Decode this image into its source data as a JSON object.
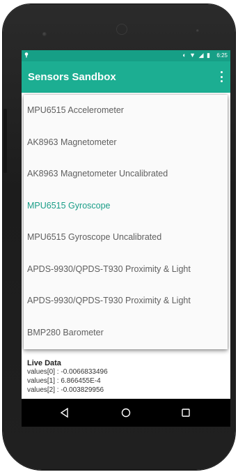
{
  "status_bar": {
    "time": "6:25",
    "icons": [
      "notification-icon",
      "sync-icon",
      "wifi-icon",
      "signal-icon",
      "battery-icon"
    ]
  },
  "app_bar": {
    "title": "Sensors Sandbox",
    "menu_icon": "overflow-menu-icon"
  },
  "sensor_menu": {
    "items": [
      {
        "label": "MPU6515 Accelerometer",
        "selected": false
      },
      {
        "label": "AK8963 Magnetometer",
        "selected": false
      },
      {
        "label": "AK8963 Magnetometer Uncalibrated",
        "selected": false
      },
      {
        "label": "MPU6515 Gyroscope",
        "selected": true
      },
      {
        "label": "MPU6515 Gyroscope Uncalibrated",
        "selected": false
      },
      {
        "label": "APDS-9930/QPDS-T930 Proximity & Light",
        "selected": false
      },
      {
        "label": "APDS-9930/QPDS-T930 Proximity & Light",
        "selected": false
      },
      {
        "label": "BMP280 Barometer",
        "selected": false
      }
    ]
  },
  "live_data": {
    "title": "Live Data",
    "lines": [
      "values[0] : -0.0066833496",
      "values[1] : 6.866455E-4",
      "values[2] : -0.003829956"
    ]
  },
  "nav_bar": {
    "buttons": [
      "back-icon",
      "home-icon",
      "recents-icon"
    ]
  },
  "colors": {
    "accent": "#1cae92",
    "status_bar": "#169f86",
    "selected_text": "#1a9e88"
  }
}
